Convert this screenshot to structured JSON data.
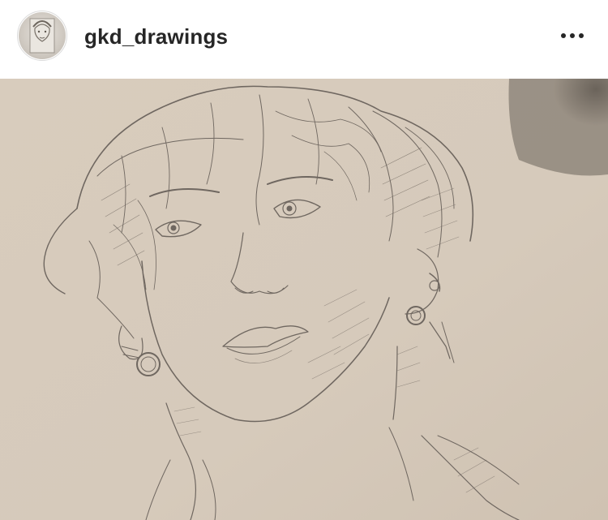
{
  "post": {
    "username": "gkd_drawings",
    "avatar_icon": "profile-photo-avatar",
    "more_icon": "more-options-icon",
    "image_subject": "pencil sketch"
  },
  "colors": {
    "text_primary": "#262626",
    "paper": "#d9cdbf",
    "pencil": "#6f6760"
  }
}
